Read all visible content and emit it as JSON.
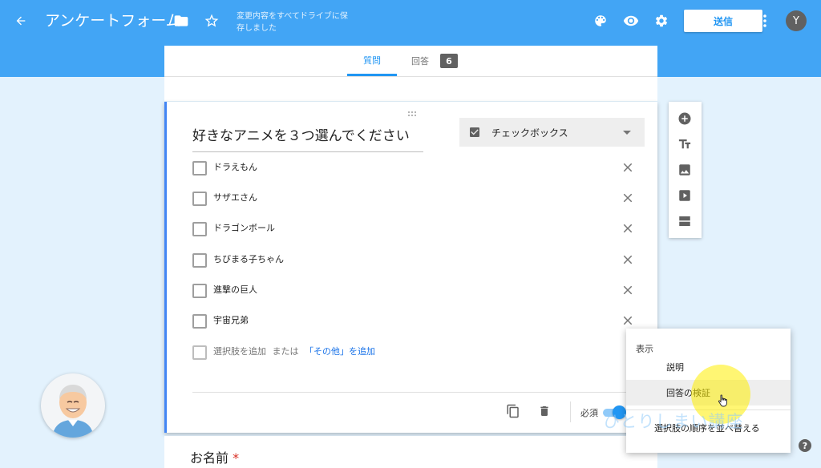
{
  "header": {
    "title": "アンケートフォーム",
    "saved_status": "変更内容をすべてドライブに保存しました",
    "send_label": "送信",
    "avatar_initial": "Y",
    "icons": [
      "back-arrow-icon",
      "folder-icon",
      "star-outline-icon",
      "palette-icon",
      "eye-icon",
      "gear-icon",
      "more-vert-icon"
    ],
    "color": "#42a5f5"
  },
  "tabs": {
    "questions": "質問",
    "responses": "回答",
    "response_count": "6"
  },
  "question": {
    "title": "好きなアニメを３つ選んでください",
    "type": "チェックボックス",
    "options": [
      {
        "label": "ドラえもん"
      },
      {
        "label": "サザエさん"
      },
      {
        "label": "ドラゴンボール"
      },
      {
        "label": "ちびまる子ちゃん"
      },
      {
        "label": "進撃の巨人"
      },
      {
        "label": "宇宙兄弟"
      }
    ],
    "add_option": "選択肢を追加",
    "or": "または",
    "add_other": "「その他」を追加",
    "required_label": "必須",
    "required": true
  },
  "next_question": {
    "title": "お名前",
    "required_mark": "*"
  },
  "side_tools": [
    "add-question-icon",
    "add-title-icon",
    "add-image-icon",
    "add-video-icon",
    "add-section-icon"
  ],
  "menu": {
    "heading": "表示",
    "items": [
      {
        "label": "説明"
      },
      {
        "label": "回答の検証"
      },
      {
        "label": "選択肢の順序を並べ替える"
      }
    ]
  },
  "watermark": "ひとりしまい講座",
  "help_label": "?"
}
